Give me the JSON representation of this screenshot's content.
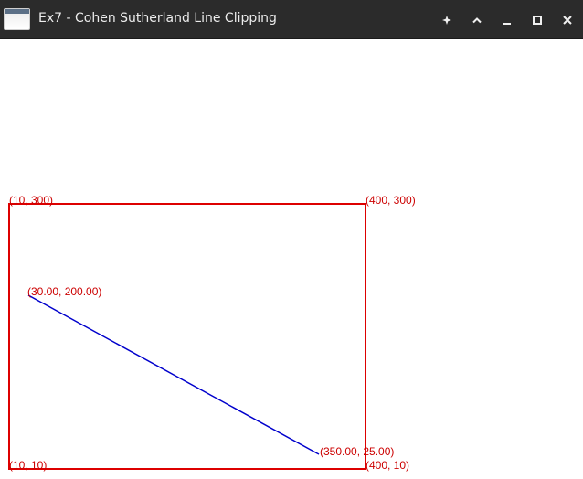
{
  "window": {
    "title": "Ex7 - Cohen Sutherland Line Clipping",
    "controls": [
      "pin-icon",
      "chevron-up-icon",
      "minimize-icon",
      "maximize-icon",
      "close-icon"
    ]
  },
  "clip_window": {
    "color": "#dd0000",
    "corners": {
      "top_left": "(10, 300)",
      "top_right": "(400, 300)",
      "bottom_left": "(10, 10)",
      "bottom_right": "(400, 10)"
    }
  },
  "line": {
    "color": "#0000cc",
    "start_label": "(30.00, 200.00)",
    "end_label": "(350.00, 25.00)"
  }
}
